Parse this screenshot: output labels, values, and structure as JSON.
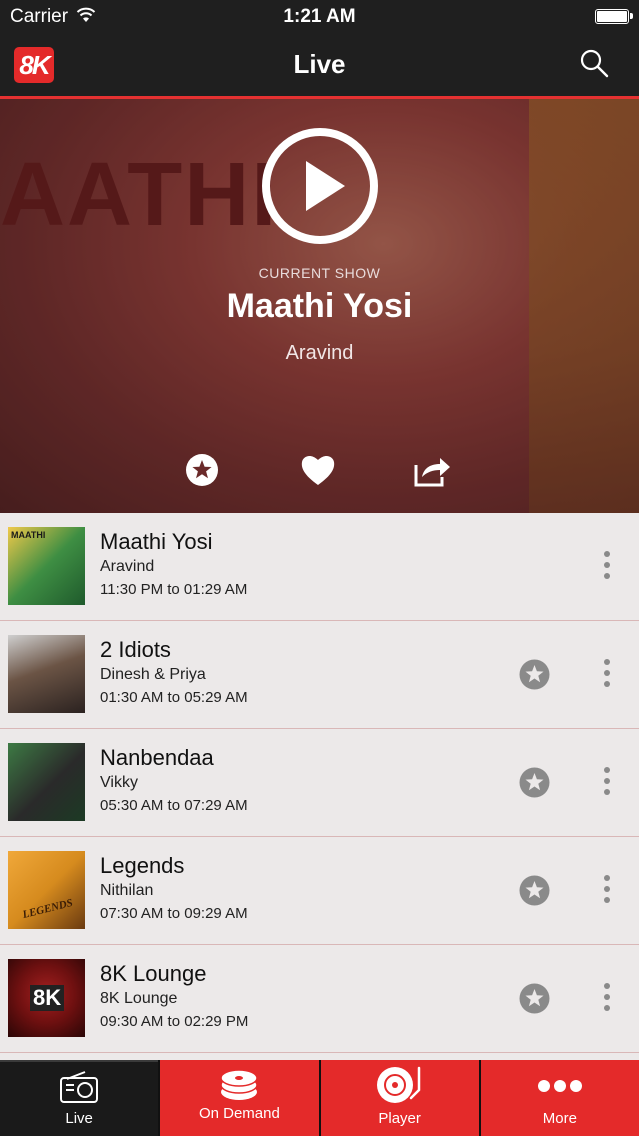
{
  "status": {
    "carrier": "Carrier",
    "time": "1:21 AM"
  },
  "nav": {
    "logo": "8K",
    "title": "Live"
  },
  "hero": {
    "bg_text": "AATHI",
    "current_label": "CURRENT SHOW",
    "title": "Maathi Yosi",
    "host": "Aravind"
  },
  "shows": [
    {
      "title": "Maathi Yosi",
      "host": "Aravind",
      "time": "11:30 PM to 01:29 AM",
      "thumb_text": "MAATHI",
      "thumb_color": "#3e8e43"
    },
    {
      "title": "2 Idiots",
      "host": "Dinesh & Priya",
      "time": "01:30 AM to 05:29 AM",
      "thumb_text": "",
      "thumb_color": "#5e4a3e"
    },
    {
      "title": "Nanbendaa",
      "host": "Vikky",
      "time": "05:30 AM to 07:29 AM",
      "thumb_text": "",
      "thumb_color": "#2f6b3c"
    },
    {
      "title": "Legends",
      "host": "Nithilan",
      "time": "07:30 AM to 09:29 AM",
      "thumb_text": "LEGENDS",
      "thumb_color": "#d68b1e"
    },
    {
      "title": "8K Lounge",
      "host": "8K Lounge",
      "time": "09:30 AM to 02:29 PM",
      "thumb_text": "8K",
      "thumb_color": "#7a1414"
    }
  ],
  "tabs": [
    {
      "label": "Live",
      "icon": "radio-icon"
    },
    {
      "label": "On Demand",
      "icon": "disc-stack-icon"
    },
    {
      "label": "Player",
      "icon": "turntable-icon"
    },
    {
      "label": "More",
      "icon": "dots-icon"
    }
  ],
  "colors": {
    "accent": "#e42a2a",
    "bar": "#1f1f1f"
  }
}
